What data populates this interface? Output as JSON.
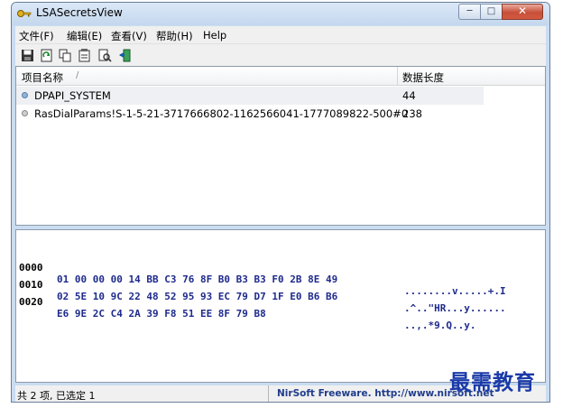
{
  "window": {
    "title": "LSASecretsView"
  },
  "menu": [
    "文件(F)",
    "编辑(E)",
    "查看(V)",
    "帮助(H)",
    "Help"
  ],
  "toolbar": {
    "icons": [
      "save-icon",
      "refresh-icon",
      "copy-icon",
      "properties-icon",
      "find-icon",
      "exit-icon"
    ]
  },
  "list": {
    "columns": {
      "name": "项目名称",
      "sort_indicator": "/",
      "length": "数据长度"
    },
    "rows": [
      {
        "name": "DPAPI_SYSTEM",
        "length": "44"
      },
      {
        "name": "RasDialParams!S-1-5-21-3717666802-1162566041-1777089822-500#0",
        "length": "238"
      }
    ]
  },
  "hex": {
    "lines": [
      {
        "offset": "0000",
        "bytes": "01 00 00 00 14 BB C3 76 8F B0 B3 B3 F0 2B 8E 49",
        "ascii": "........v.....+.I"
      },
      {
        "offset": "0010",
        "bytes": "02 5E 10 9C 22 48 52 95 93 EC 79 D7 1F E0 B6 B6",
        "ascii": ".^..\"HR...y......"
      },
      {
        "offset": "0020",
        "bytes": "E6 9E 2C C4 2A 39 F8 51 EE 8F 79 B8",
        "ascii": "..,.*9.Q..y."
      }
    ]
  },
  "status": {
    "left": "共 2 项, 已选定 1",
    "right": "NirSoft Freeware.  http://www.nirsoft.net"
  },
  "watermark": "最需教育"
}
